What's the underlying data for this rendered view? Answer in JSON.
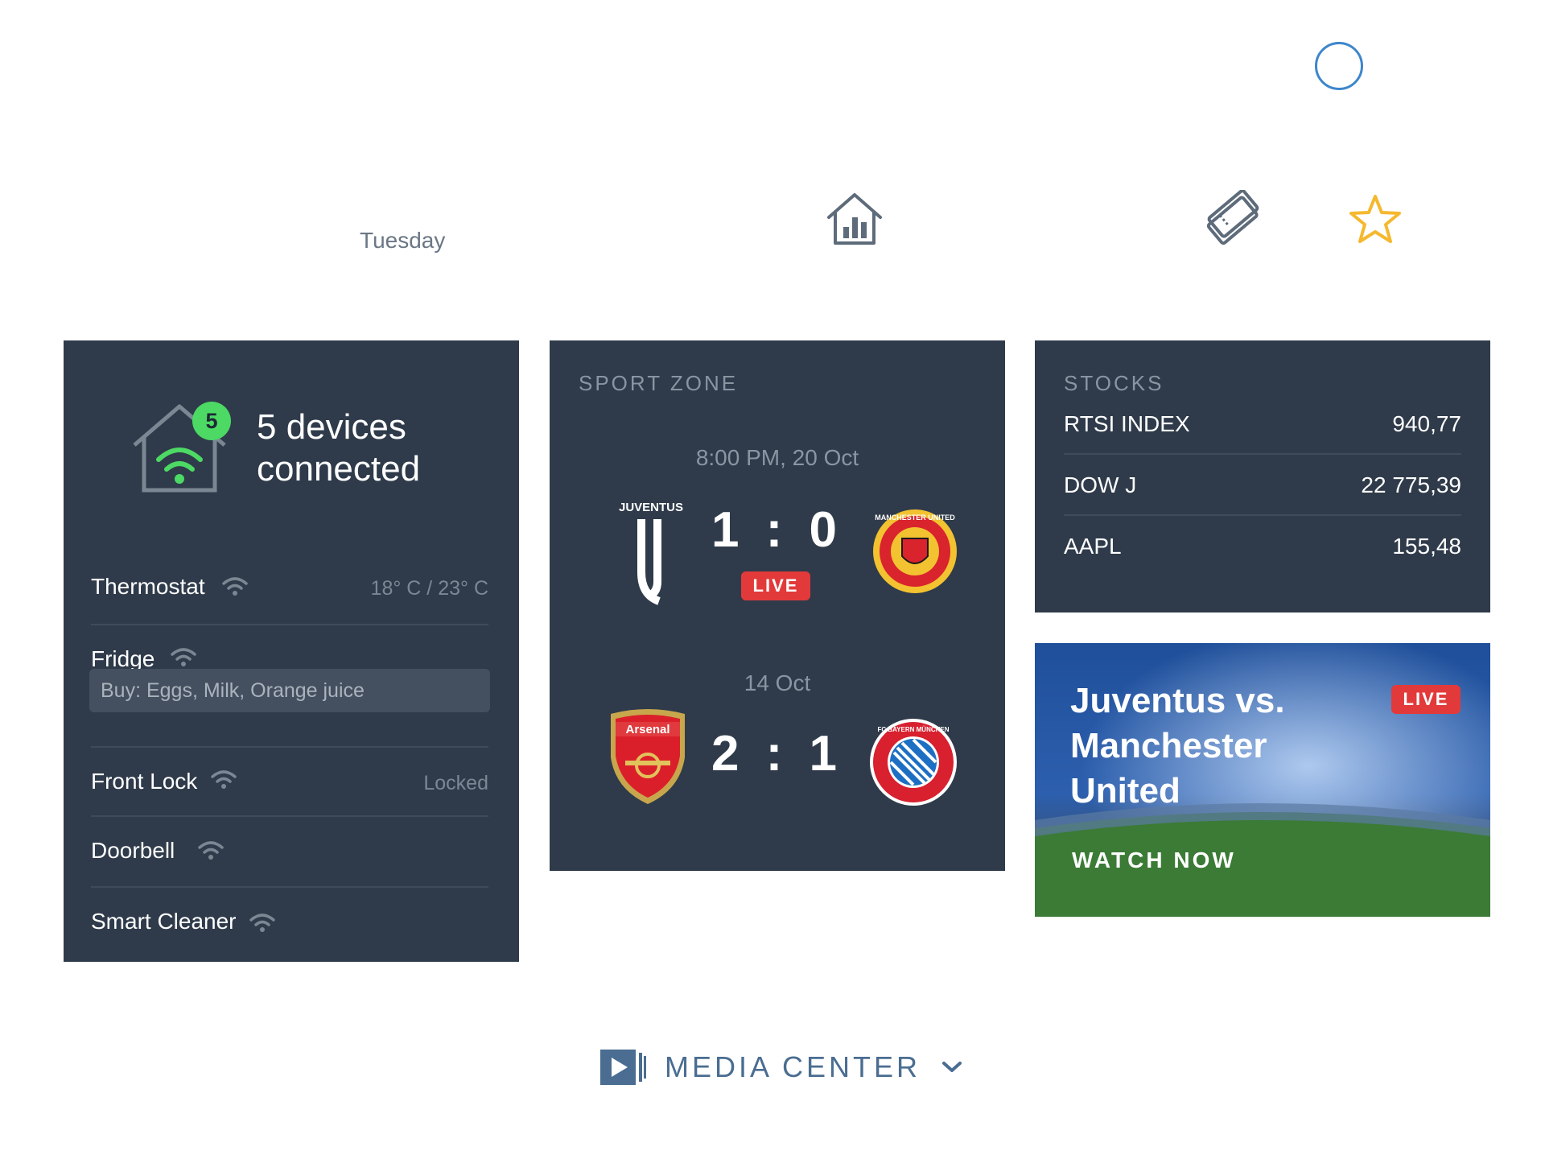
{
  "header": {
    "day": "Tuesday"
  },
  "smart_home": {
    "device_count": "5",
    "connected_label": "5 devices connected",
    "devices": [
      {
        "name": "Thermostat",
        "status": "18° C / 23° C"
      },
      {
        "name": "Fridge",
        "note_placeholder": "Buy: Eggs, Milk, Orange juice"
      },
      {
        "name": "Front Lock",
        "status": "Locked"
      },
      {
        "name": "Doorbell",
        "status": ""
      },
      {
        "name": "Smart Cleaner",
        "status": ""
      }
    ],
    "accent_color": "#4cd964"
  },
  "sport_zone": {
    "title": "SPORT ZONE",
    "matches": [
      {
        "time": "8:00 PM, 20 Oct",
        "home_crest_text": "JUVENTUS",
        "away_crest_text": "MANCHESTER UNITED",
        "score": "1 : 0",
        "live": "LIVE"
      },
      {
        "time": "14 Oct",
        "home_crest_text": "Arsenal",
        "away_crest_text": "FC BAYERN MÜNCHEN",
        "score": "2 : 1"
      }
    ]
  },
  "stocks": {
    "title": "STOCKS",
    "items": [
      {
        "name": "RTSI INDEX",
        "value": "940,77"
      },
      {
        "name": "DOW J",
        "value": "22 775,39"
      },
      {
        "name": "AAPL",
        "value": "155,48"
      }
    ]
  },
  "promo": {
    "title": "Juventus vs. Manchester United",
    "live": "LIVE",
    "cta": "WATCH NOW"
  },
  "footer": {
    "media_center": "MEDIA CENTER"
  },
  "colors": {
    "card_bg": "#2f3b4a",
    "live_red": "#e23a3a",
    "star_yellow": "#f5b82e",
    "link_blue": "#4a6d91"
  },
  "icons": [
    "profile-ring-icon",
    "home-stats-icon",
    "tickets-icon",
    "star-icon",
    "house-wifi-icon",
    "wifi-icon",
    "media-play-icon",
    "chevron-down-icon"
  ]
}
